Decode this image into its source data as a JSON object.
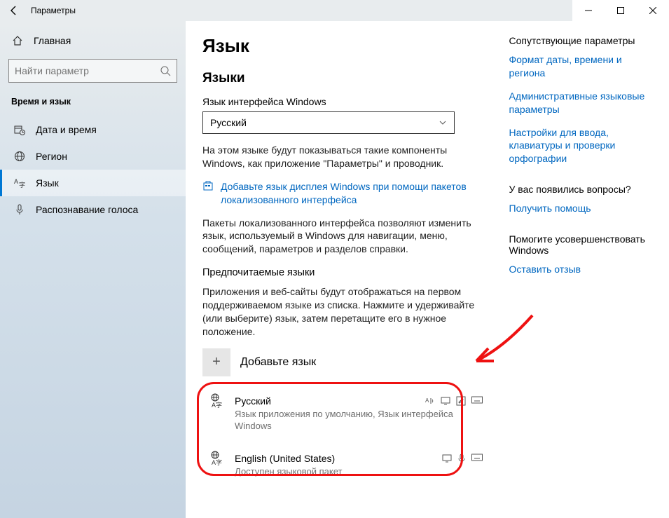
{
  "window": {
    "title": "Параметры"
  },
  "sidebar": {
    "home": "Главная",
    "search_placeholder": "Найти параметр",
    "section": "Время и язык",
    "items": [
      {
        "label": "Дата и время"
      },
      {
        "label": "Регион"
      },
      {
        "label": "Язык"
      },
      {
        "label": "Распознавание голоса"
      }
    ]
  },
  "main": {
    "title": "Язык",
    "languages_header": "Языки",
    "display_lang_label": "Язык интерфейса Windows",
    "display_lang_value": "Русский",
    "display_lang_desc": "На этом языке будут показываться такие компоненты Windows, как приложение \"Параметры\" и проводник.",
    "store_link": "Добавьте язык дисплея Windows при помощи пакетов локализованного интерфейса",
    "localization_desc": "Пакеты локализованного интерфейса позволяют изменить язык, используемый в Windows для навигации, меню, сообщений, параметров и разделов справки.",
    "preferred_header": "Предпочитаемые языки",
    "preferred_desc": "Приложения и веб-сайты будут отображаться на первом поддерживаемом языке из списка. Нажмите и удерживайте (или выберите) язык, затем перетащите его в нужное положение.",
    "add_language": "Добавьте язык",
    "langs": [
      {
        "name": "Русский",
        "sub": "Язык приложения по умолчанию, Язык интерфейса Windows"
      },
      {
        "name": "English (United States)",
        "sub": "Доступен языковой пакет"
      }
    ]
  },
  "right": {
    "related_header": "Сопутствующие параметры",
    "link_date": "Формат даты, времени и региона",
    "link_admin": "Административные языковые параметры",
    "link_input": "Настройки для ввода, клавиатуры и проверки орфографии",
    "question_header": "У вас появились вопросы?",
    "get_help": "Получить помощь",
    "improve_header": "Помогите усовершенствовать Windows",
    "feedback": "Оставить отзыв"
  }
}
